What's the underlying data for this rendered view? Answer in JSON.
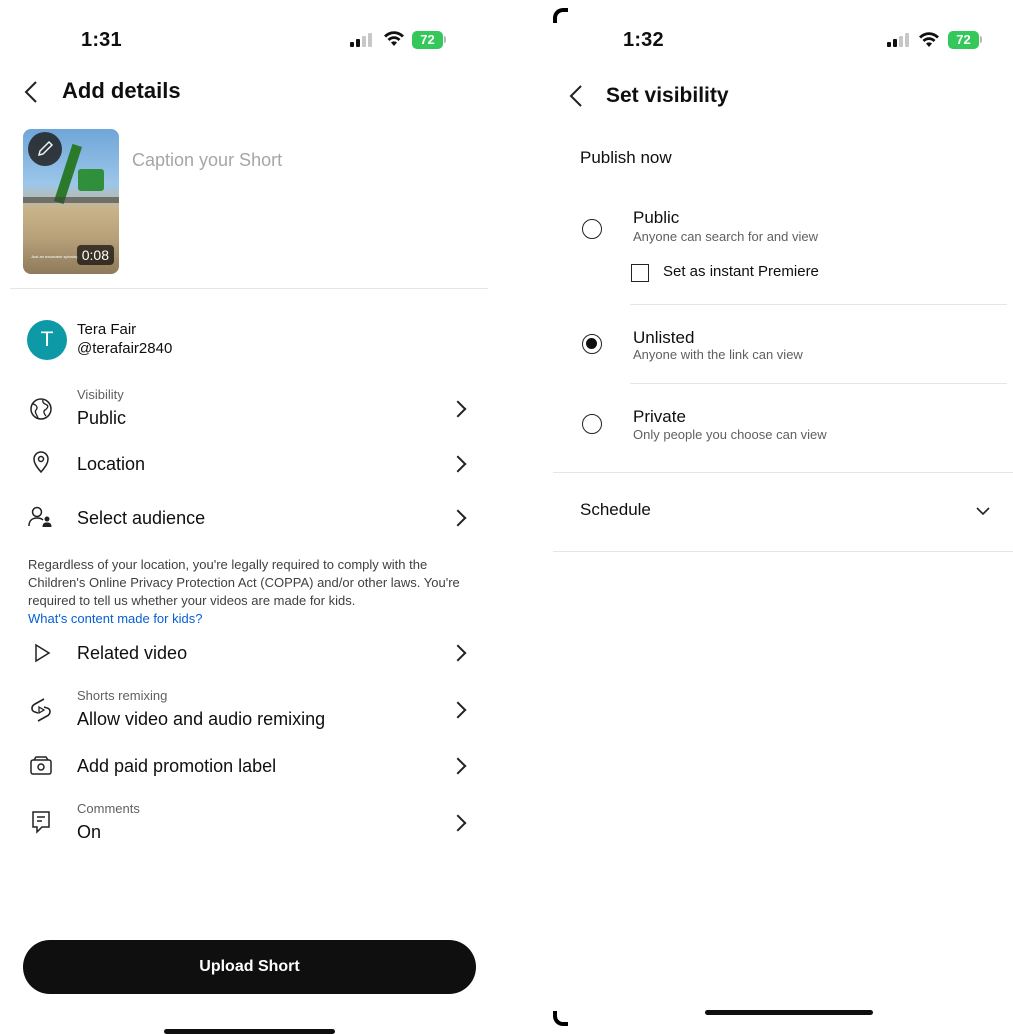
{
  "left": {
    "status": {
      "time": "1:31",
      "battery": "72"
    },
    "header": {
      "title": "Add details"
    },
    "thumbnail": {
      "duration": "0:08",
      "overlay_text": "Just an excavator spinning"
    },
    "caption": {
      "placeholder": "Caption your Short"
    },
    "channel": {
      "initial": "T",
      "name": "Tera Fair",
      "handle": "@terafair2840"
    },
    "settings": {
      "visibility": {
        "label": "Visibility",
        "value": "Public"
      },
      "location": {
        "value": "Location"
      },
      "audience": {
        "value": "Select audience"
      }
    },
    "coppa": {
      "text": "Regardless of your location, you're legally required to comply with the Children's Online Privacy Protection Act (COPPA) and/or other laws. You're required to tell us whether your videos are made for kids.",
      "link": "What's content made for kids?"
    },
    "more": {
      "related": {
        "value": "Related video"
      },
      "remix": {
        "label": "Shorts remixing",
        "value": "Allow video and audio remixing"
      },
      "promo": {
        "value": "Add paid promotion label"
      },
      "comments": {
        "label": "Comments",
        "value": "On"
      }
    },
    "upload_button": "Upload Short"
  },
  "right": {
    "status": {
      "time": "1:32",
      "battery": "72"
    },
    "header": {
      "title": "Set visibility"
    },
    "publish_now": "Publish now",
    "options": {
      "public": {
        "title": "Public",
        "desc": "Anyone can search for and view"
      },
      "premiere": "Set as instant Premiere",
      "unlisted": {
        "title": "Unlisted",
        "desc": "Anyone with the link can view",
        "selected": true
      },
      "private": {
        "title": "Private",
        "desc": "Only people you choose can view"
      }
    },
    "schedule": "Schedule"
  },
  "colors": {
    "accent_link": "#065fd4",
    "avatar": "#0d9aa6",
    "battery": "#34c759",
    "button": "#0f0f0f"
  }
}
